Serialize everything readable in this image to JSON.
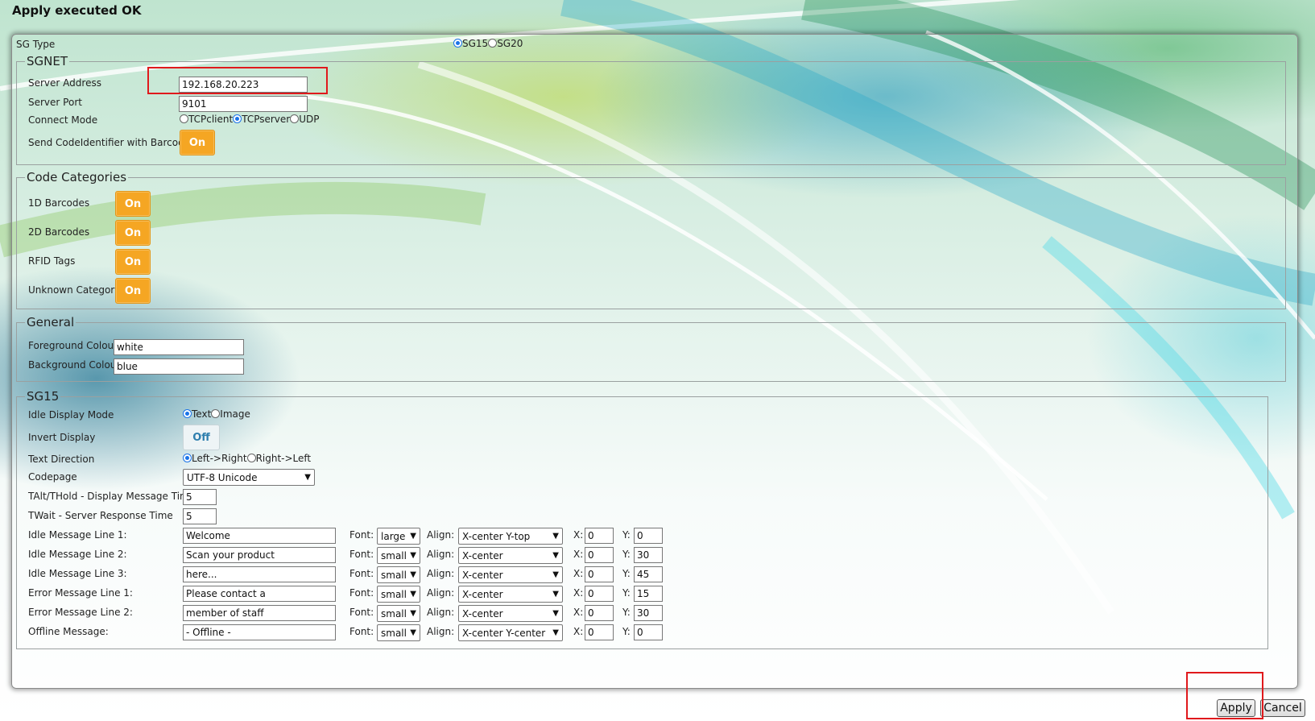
{
  "status": "Apply executed OK",
  "sg_type": {
    "label": "SG Type",
    "options": [
      "SG15",
      "SG20"
    ],
    "selected": "SG15"
  },
  "sgnet": {
    "legend": "SGNET",
    "server_address": {
      "label": "Server Address",
      "value": "192.168.20.223"
    },
    "server_port": {
      "label": "Server Port",
      "value": "9101"
    },
    "connect_mode": {
      "label": "Connect Mode",
      "options": [
        "TCPclient",
        "TCPserver",
        "UDP"
      ],
      "selected": "TCPserver"
    },
    "send_code_identifier": {
      "label": "Send CodeIdentifier with Barcode",
      "state": "On"
    }
  },
  "code_categories": {
    "legend": "Code Categories",
    "items": [
      {
        "label": "1D Barcodes",
        "state": "On"
      },
      {
        "label": "2D Barcodes",
        "state": "On"
      },
      {
        "label": "RFID Tags",
        "state": "On"
      },
      {
        "label": "Unknown Category",
        "state": "On"
      }
    ]
  },
  "general": {
    "legend": "General",
    "foreground": {
      "label": "Foreground Colour",
      "value": "white"
    },
    "background": {
      "label": "Background Colour",
      "value": "blue"
    }
  },
  "sg15": {
    "legend": "SG15",
    "idle_display_mode": {
      "label": "Idle Display Mode",
      "options": [
        "Text",
        "Image"
      ],
      "selected": "Text"
    },
    "invert_display": {
      "label": "Invert Display",
      "state": "Off"
    },
    "text_direction": {
      "label": "Text Direction",
      "options": [
        "Left->Right",
        "Right->Left"
      ],
      "selected": "Left->Right"
    },
    "codepage": {
      "label": "Codepage",
      "value": "UTF-8 Unicode"
    },
    "talt": {
      "label": "TAlt/THold - Display Message Time",
      "value": "5"
    },
    "twait": {
      "label": "TWait - Server Response Time",
      "value": "5"
    },
    "font_label": "Font:",
    "align_label": "Align:",
    "x_label": "X:",
    "y_label": "Y:",
    "lines": [
      {
        "label": "Idle Message Line 1:",
        "text": "Welcome",
        "font": "large",
        "align": "X-center Y-top",
        "x": "0",
        "y": "0"
      },
      {
        "label": "Idle Message Line 2:",
        "text": "Scan your product",
        "font": "small",
        "align": "X-center",
        "x": "0",
        "y": "30"
      },
      {
        "label": "Idle Message Line 3:",
        "text": "here...",
        "font": "small",
        "align": "X-center",
        "x": "0",
        "y": "45"
      },
      {
        "label": "Error Message Line 1:",
        "text": "Please contact a",
        "font": "small",
        "align": "X-center",
        "x": "0",
        "y": "15"
      },
      {
        "label": "Error Message Line 2:",
        "text": "member of staff",
        "font": "small",
        "align": "X-center",
        "x": "0",
        "y": "30"
      },
      {
        "label": "Offline Message:",
        "text": "- Offline -",
        "font": "small",
        "align": "X-center Y-center",
        "x": "0",
        "y": "0"
      }
    ]
  },
  "buttons": {
    "apply": "Apply",
    "cancel": "Cancel"
  },
  "colors": {
    "toggle_on": "#f5a623",
    "highlight": "#e0191c",
    "radio": "#1a73e8"
  }
}
